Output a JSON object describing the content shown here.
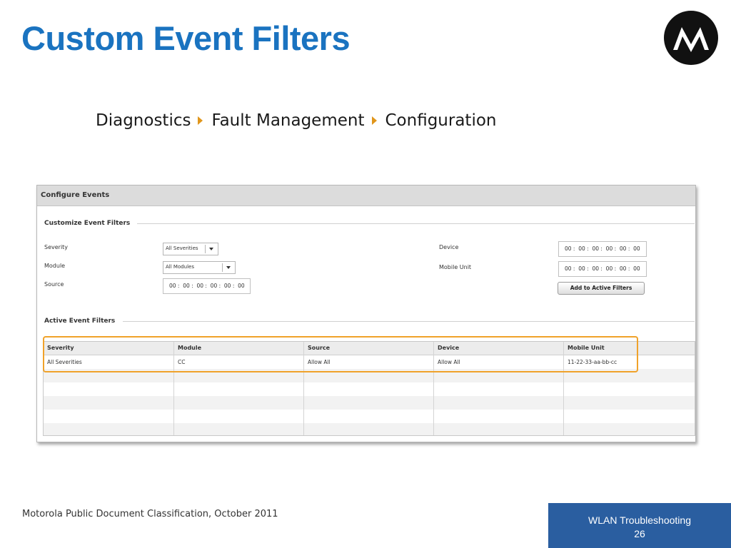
{
  "slide": {
    "title": "Custom Event Filters",
    "breadcrumb": [
      "Diagnostics",
      "Fault Management",
      "Configuration"
    ],
    "footer_left": "Motorola Public Document Classification, October 2011",
    "footer_right_title": "WLAN Troubleshooting",
    "page_number": "26",
    "accent_color": "#1a73c0",
    "footer_color": "#2a5ea0",
    "highlight_color": "#f0a22a",
    "logo_icon": "motorola-logo"
  },
  "panel": {
    "title": "Configure Events",
    "customize": {
      "section_title": "Customize Event Filters",
      "severity_label": "Severity",
      "severity_value": "All Severities",
      "module_label": "Module",
      "module_value": "All Modules",
      "source_label": "Source",
      "source_value": "00 :  00 :  00 :  00 :  00 :  00",
      "device_label": "Device",
      "device_value": "00 :  00 :  00 :  00 :  00 :  00",
      "mobile_unit_label": "Mobile Unit",
      "mobile_unit_value": "00 :  00 :  00 :  00 :  00 :  00",
      "add_button": "Add to Active Filters"
    },
    "active": {
      "section_title": "Active Event Filters",
      "columns": [
        "Severity",
        "Module",
        "Source",
        "Device",
        "Mobile Unit"
      ],
      "rows": [
        [
          "All Severities",
          "CC",
          "Allow All",
          "Allow All",
          "11-22-33-aa-bb-cc"
        ]
      ]
    }
  }
}
